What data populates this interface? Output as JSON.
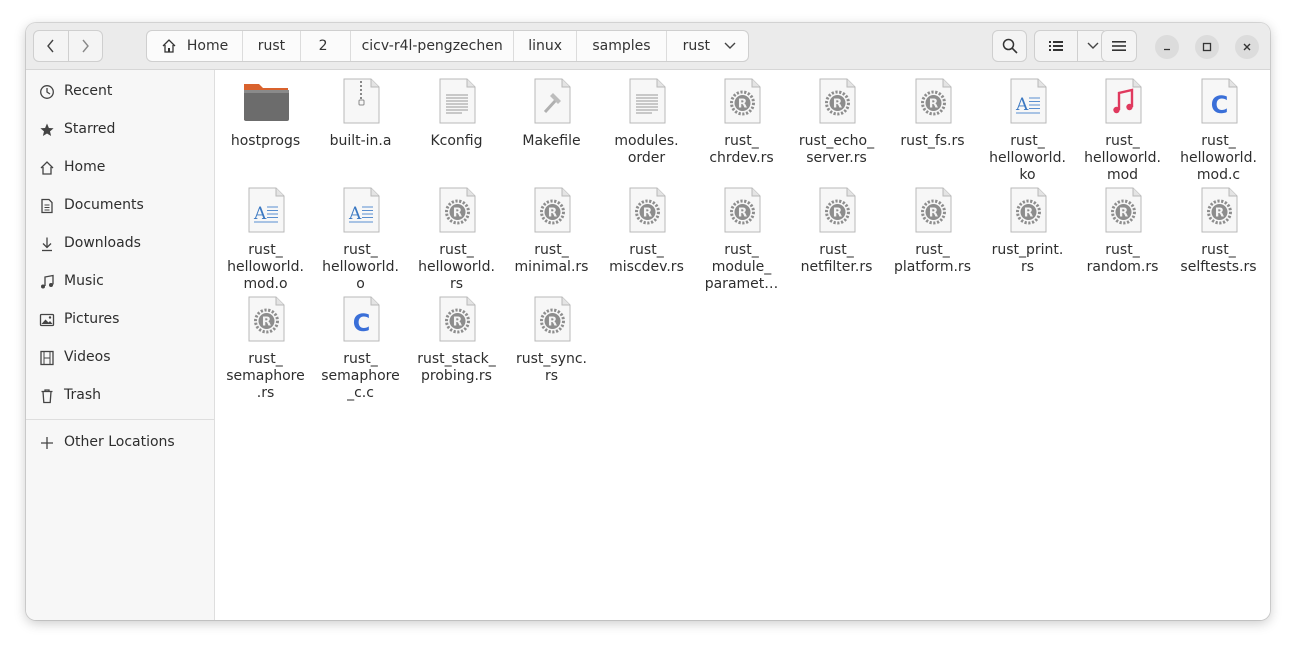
{
  "window": {
    "breadcrumbs": [
      "Home",
      "rust",
      "2",
      "cicv-r4l-pengzechen",
      "linux",
      "samples",
      "rust"
    ]
  },
  "sidebar": {
    "items": [
      {
        "label": "Recent",
        "icon": "clock-icon"
      },
      {
        "label": "Starred",
        "icon": "star-icon"
      },
      {
        "label": "Home",
        "icon": "home-icon"
      },
      {
        "label": "Documents",
        "icon": "document-icon"
      },
      {
        "label": "Downloads",
        "icon": "download-icon"
      },
      {
        "label": "Music",
        "icon": "music-note-icon"
      },
      {
        "label": "Pictures",
        "icon": "picture-icon"
      },
      {
        "label": "Videos",
        "icon": "film-icon"
      },
      {
        "label": "Trash",
        "icon": "trash-icon"
      }
    ],
    "other_locations": "Other Locations"
  },
  "files": [
    {
      "name": "hostprogs",
      "type": "folder"
    },
    {
      "name": "built-in.a",
      "type": "archive"
    },
    {
      "name": "Kconfig",
      "type": "text"
    },
    {
      "name": "Makefile",
      "type": "makefile"
    },
    {
      "name": "modules.\norder",
      "type": "text"
    },
    {
      "name": "rust_\nchrdev.rs",
      "type": "rust"
    },
    {
      "name": "rust_echo_\nserver.rs",
      "type": "rust"
    },
    {
      "name": "rust_fs.rs",
      "type": "rust"
    },
    {
      "name": "rust_\nhelloworld.\nko",
      "type": "doc"
    },
    {
      "name": "rust_\nhelloworld.\nmod",
      "type": "audio"
    },
    {
      "name": "rust_\nhelloworld.\nmod.c",
      "type": "c"
    },
    {
      "name": "rust_\nhelloworld.\nmod.o",
      "type": "doc"
    },
    {
      "name": "rust_\nhelloworld.\no",
      "type": "doc"
    },
    {
      "name": "rust_\nhelloworld.\nrs",
      "type": "rust"
    },
    {
      "name": "rust_\nminimal.rs",
      "type": "rust"
    },
    {
      "name": "rust_\nmiscdev.rs",
      "type": "rust"
    },
    {
      "name": "rust_\nmodule_\nparamet…",
      "type": "rust"
    },
    {
      "name": "rust_\nnetfilter.rs",
      "type": "rust"
    },
    {
      "name": "rust_\nplatform.rs",
      "type": "rust"
    },
    {
      "name": "rust_print.\nrs",
      "type": "rust"
    },
    {
      "name": "rust_\nrandom.rs",
      "type": "rust"
    },
    {
      "name": "rust_\nselftests.rs",
      "type": "rust"
    },
    {
      "name": "rust_\nsemaphore\n.rs",
      "type": "rust"
    },
    {
      "name": "rust_\nsemaphore\n_c.c",
      "type": "c"
    },
    {
      "name": "rust_stack_\nprobing.rs",
      "type": "rust"
    },
    {
      "name": "rust_sync.\nrs",
      "type": "rust"
    }
  ],
  "colors": {
    "folder": "#6f6f6f",
    "folder_tab": "#e06c3c",
    "c_blue": "#3a6fd8",
    "music_red": "#e0395e"
  }
}
